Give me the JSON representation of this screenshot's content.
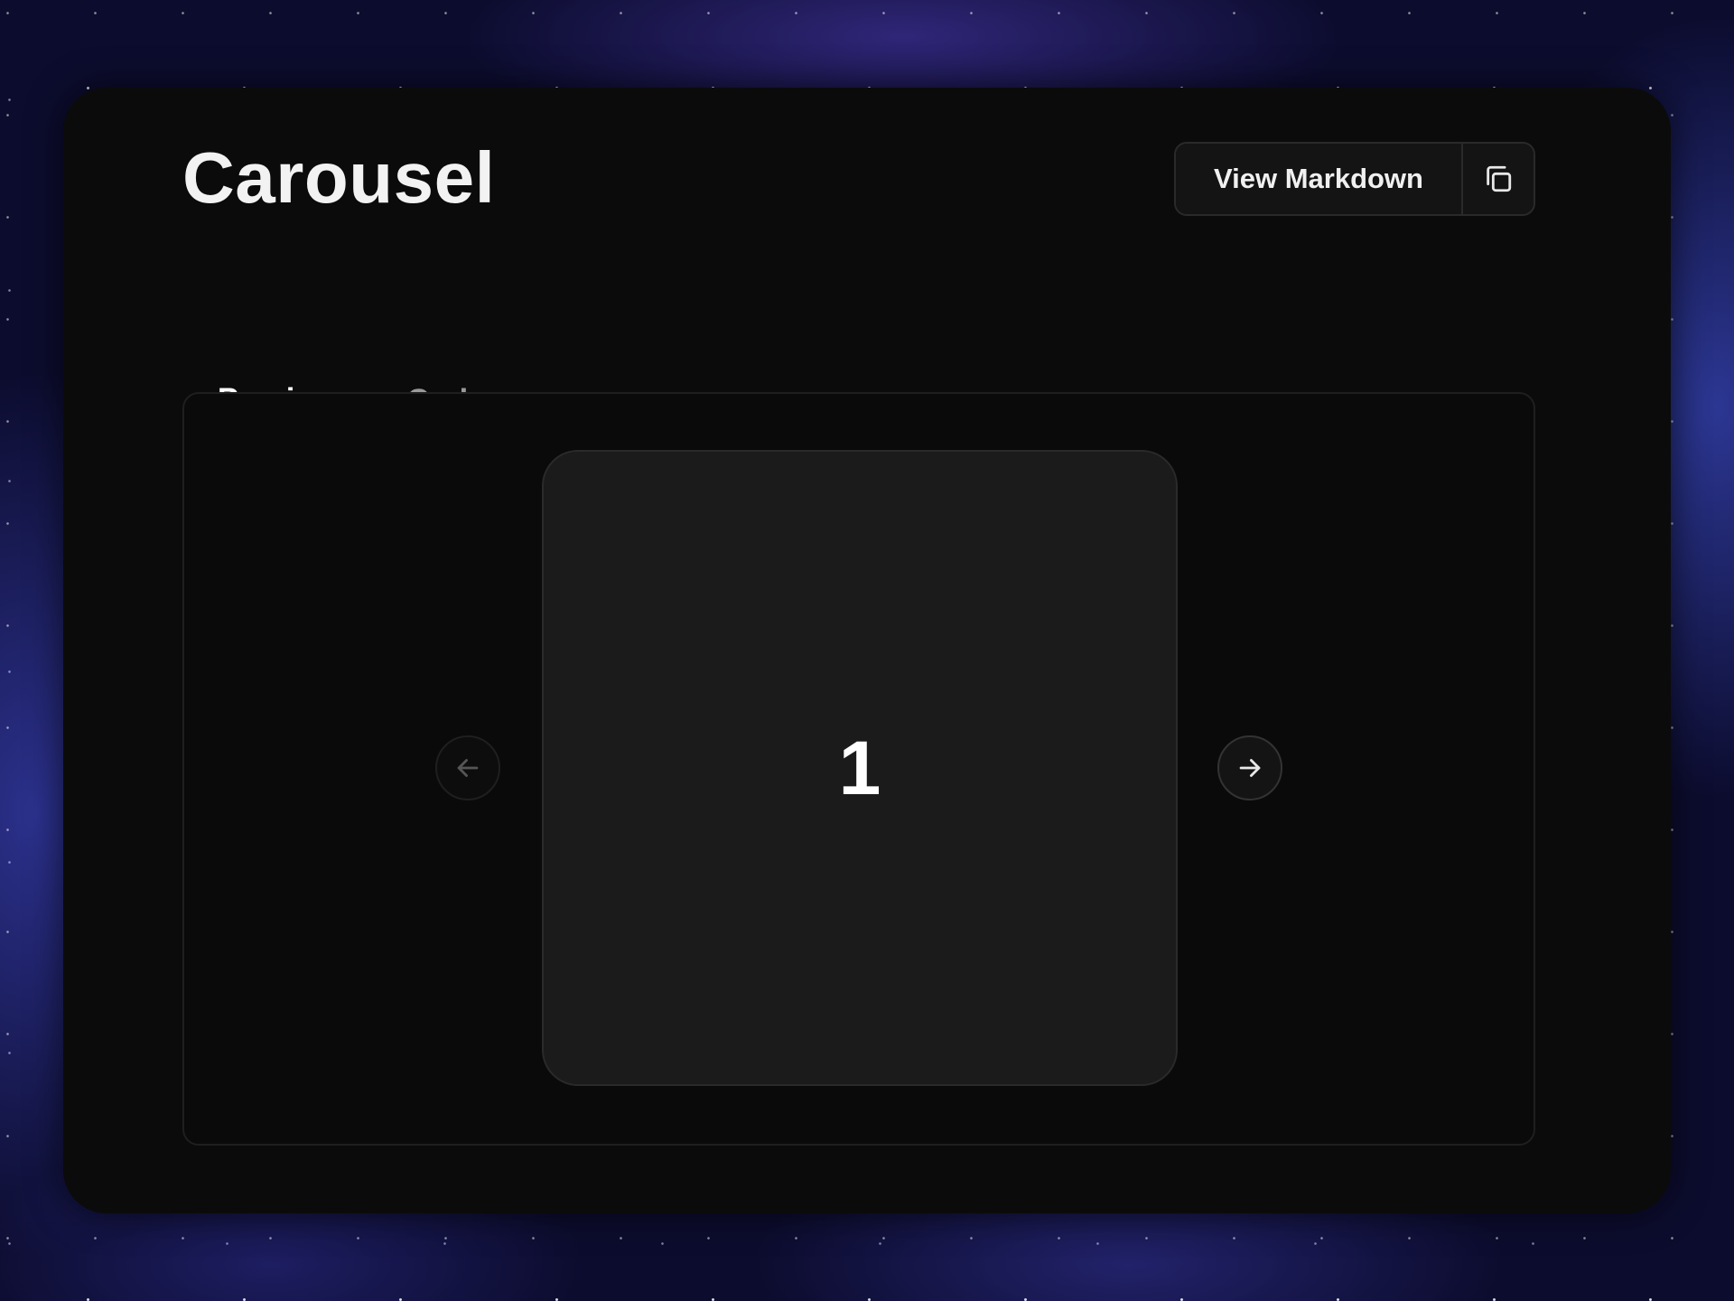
{
  "page": {
    "title": "Carousel"
  },
  "header": {
    "view_markdown_label": "View Markdown",
    "copy_icon": "copy-icon"
  },
  "tabs": [
    {
      "label": "Preview",
      "active": true
    },
    {
      "label": "Code",
      "active": false
    }
  ],
  "carousel": {
    "current_slide": "1",
    "prev_icon": "arrow-left-icon",
    "next_icon": "arrow-right-icon",
    "prev_disabled": true
  },
  "colors": {
    "panel_background": "#0b0b0b",
    "slide_background": "#1b1b1b",
    "text_primary": "#ffffff",
    "text_muted": "#9a9a9a",
    "border": "#2a2a2a"
  }
}
